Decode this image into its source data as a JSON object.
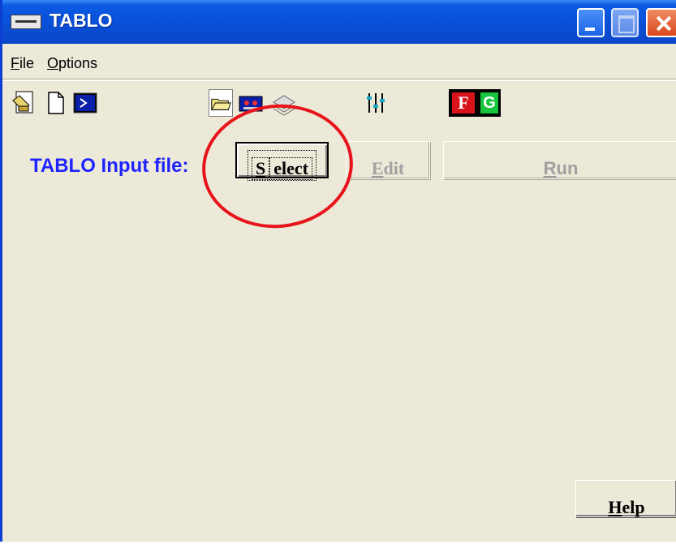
{
  "window": {
    "title": "TABLO"
  },
  "menu": [
    {
      "label": "File",
      "mnemonic": "F",
      "rest": "ile"
    },
    {
      "label": "Options",
      "mnemonic": "O",
      "rest": "ptions"
    }
  ],
  "toolbar": {
    "icons": [
      "edit-document-icon",
      "new-file-icon",
      "command-prompt-icon",
      "open-folder-icon",
      "tape-icon",
      "layers-icon",
      "sliders-icon",
      "f-icon",
      "g-icon"
    ],
    "f_label": "F",
    "g_label": "G"
  },
  "main": {
    "input_label": "TABLO Input file:",
    "select_label": "Select",
    "select_mnemonic": "S",
    "select_rest": "elect",
    "edit_label": "Edit",
    "edit_mnemonic": "E",
    "edit_rest": "dit",
    "run_label": "Run",
    "run_mnemonic": "R",
    "run_rest": "un",
    "help_label": "Help",
    "help_mnemonic": "H",
    "help_rest": "elp"
  },
  "colors": {
    "title_bar": "#0b4fd7",
    "label_blue": "#1f23ff",
    "annotation_red": "#e8141b",
    "disabled_text": "#a0a0a0",
    "window_bg": "#ece9d8"
  }
}
